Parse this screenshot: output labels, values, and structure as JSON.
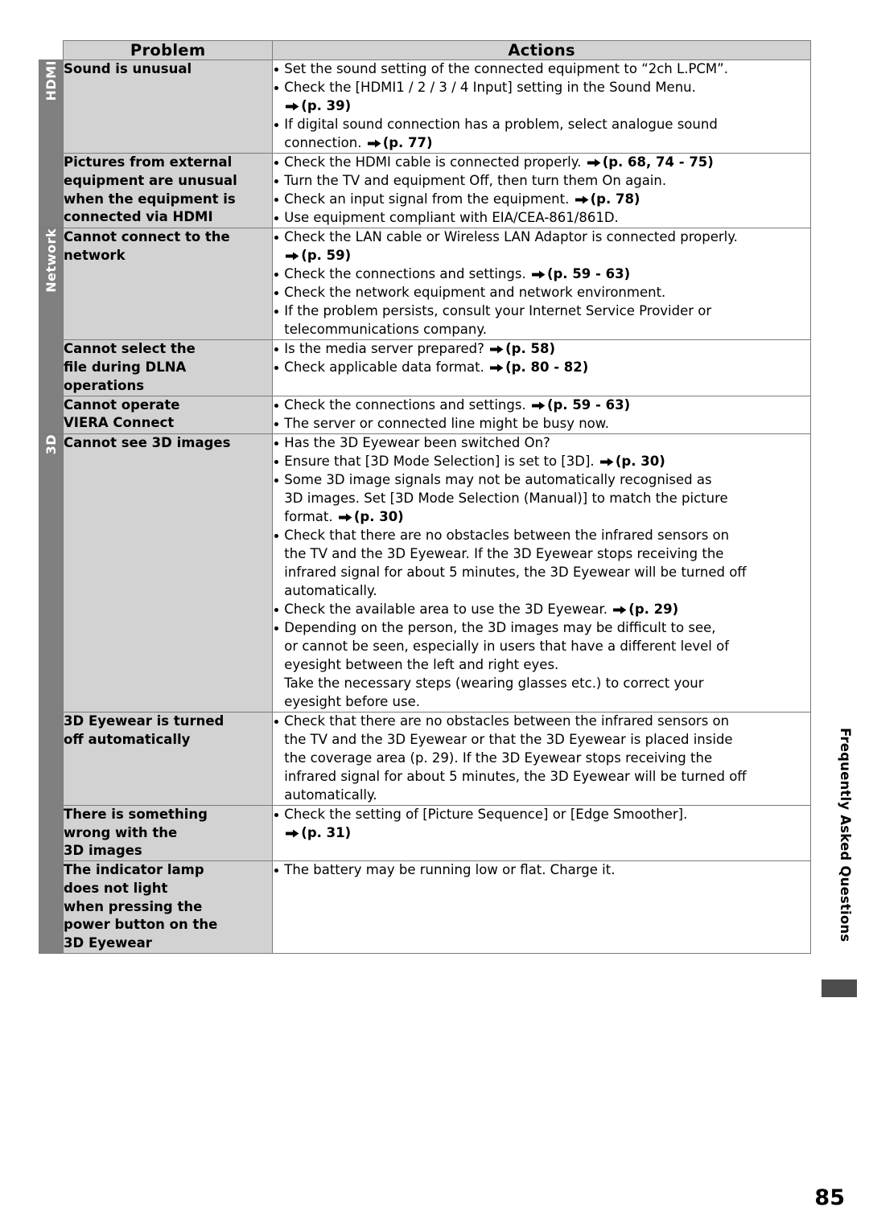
{
  "header": {
    "problem": "Problem",
    "actions": "Actions"
  },
  "side_caption": "Frequently Asked Questions",
  "page_number": "85",
  "tabs": {
    "hdmi": "HDMI",
    "network": "Network",
    "three_d": "3D"
  },
  "rows": [
    {
      "problem": [
        "Sound is unusual"
      ],
      "actions": [
        {
          "bullet": true,
          "parts": [
            {
              "t": "Set the sound setting of the connected equipment to “2ch L.PCM”."
            }
          ]
        },
        {
          "bullet": true,
          "parts": [
            {
              "t": "Check the [HDMI1 / 2 / 3 / 4 Input] setting in the Sound Menu."
            }
          ]
        },
        {
          "bullet": false,
          "parts": [
            {
              "arrow": true
            },
            {
              "t": "(p. 39)",
              "bold": true
            }
          ]
        },
        {
          "bullet": true,
          "parts": [
            {
              "t": "If digital sound connection has a problem, select analogue sound"
            }
          ]
        },
        {
          "bullet": false,
          "parts": [
            {
              "t": "connection. "
            },
            {
              "arrow": true
            },
            {
              "t": "(p. 77)",
              "bold": true
            }
          ]
        }
      ]
    },
    {
      "problem": [
        "Pictures from external",
        "equipment are unusual",
        "when the equipment is",
        "connected via HDMI"
      ],
      "actions": [
        {
          "bullet": true,
          "parts": [
            {
              "t": "Check the HDMI cable is connected properly. "
            },
            {
              "arrow": true
            },
            {
              "t": "(p. 68, 74 - 75)",
              "bold": true
            }
          ]
        },
        {
          "bullet": true,
          "parts": [
            {
              "t": "Turn the TV and equipment Off, then turn them On again."
            }
          ]
        },
        {
          "bullet": true,
          "parts": [
            {
              "t": "Check an input signal from the equipment. "
            },
            {
              "arrow": true
            },
            {
              "t": "(p. 78)",
              "bold": true
            }
          ]
        },
        {
          "bullet": true,
          "parts": [
            {
              "t": "Use equipment compliant with EIA/CEA-861/861D."
            }
          ]
        }
      ]
    },
    {
      "problem": [
        "Cannot connect to the",
        "network"
      ],
      "actions": [
        {
          "bullet": true,
          "parts": [
            {
              "t": "Check the LAN cable or Wireless LAN Adaptor is connected properly."
            }
          ]
        },
        {
          "bullet": false,
          "parts": [
            {
              "arrow": true
            },
            {
              "t": "(p. 59)",
              "bold": true
            }
          ]
        },
        {
          "bullet": true,
          "parts": [
            {
              "t": "Check the connections and settings. "
            },
            {
              "arrow": true
            },
            {
              "t": "(p. 59 - 63)",
              "bold": true
            }
          ]
        },
        {
          "bullet": true,
          "parts": [
            {
              "t": "Check the network equipment and network environment."
            }
          ]
        },
        {
          "bullet": true,
          "parts": [
            {
              "t": "If the problem persists, consult your Internet Service Provider or"
            }
          ]
        },
        {
          "bullet": false,
          "parts": [
            {
              "t": "telecommunications company."
            }
          ]
        }
      ]
    },
    {
      "problem": [
        "Cannot select the",
        "file during DLNA",
        "operations"
      ],
      "actions": [
        {
          "bullet": true,
          "parts": [
            {
              "t": "Is the media server prepared? "
            },
            {
              "arrow": true
            },
            {
              "t": "(p. 58)",
              "bold": true
            }
          ]
        },
        {
          "bullet": true,
          "parts": [
            {
              "t": "Check applicable data format. "
            },
            {
              "arrow": true
            },
            {
              "t": "(p. 80 - 82)",
              "bold": true
            }
          ]
        }
      ]
    },
    {
      "problem": [
        "Cannot operate",
        "VIERA Connect"
      ],
      "actions": [
        {
          "bullet": true,
          "parts": [
            {
              "t": "Check the connections and settings. "
            },
            {
              "arrow": true
            },
            {
              "t": "(p. 59 - 63)",
              "bold": true
            }
          ]
        },
        {
          "bullet": true,
          "parts": [
            {
              "t": "The server or connected line might be busy now."
            }
          ]
        }
      ]
    },
    {
      "problem": [
        "Cannot see 3D images"
      ],
      "actions": [
        {
          "bullet": true,
          "parts": [
            {
              "t": "Has the 3D Eyewear been switched On?"
            }
          ]
        },
        {
          "bullet": true,
          "parts": [
            {
              "t": "Ensure that [3D Mode Selection] is set to [3D]. "
            },
            {
              "arrow": true
            },
            {
              "t": "(p. 30)",
              "bold": true
            }
          ]
        },
        {
          "bullet": true,
          "parts": [
            {
              "t": "Some 3D image signals may not be automatically recognised as"
            }
          ]
        },
        {
          "bullet": false,
          "parts": [
            {
              "t": "3D images. Set [3D Mode Selection (Manual)] to match the picture"
            }
          ]
        },
        {
          "bullet": false,
          "parts": [
            {
              "t": "format. "
            },
            {
              "arrow": true
            },
            {
              "t": "(p. 30)",
              "bold": true
            }
          ]
        },
        {
          "bullet": true,
          "parts": [
            {
              "t": "Check that there are no obstacles between the infrared sensors on"
            }
          ]
        },
        {
          "bullet": false,
          "parts": [
            {
              "t": "the TV and the 3D Eyewear. If the 3D Eyewear stops receiving the"
            }
          ]
        },
        {
          "bullet": false,
          "parts": [
            {
              "t": "infrared signal for about 5 minutes, the 3D Eyewear will be turned off"
            }
          ]
        },
        {
          "bullet": false,
          "parts": [
            {
              "t": "automatically."
            }
          ]
        },
        {
          "bullet": true,
          "parts": [
            {
              "t": "Check the available area to use the 3D Eyewear. "
            },
            {
              "arrow": true
            },
            {
              "t": "(p. 29)",
              "bold": true
            }
          ]
        },
        {
          "bullet": true,
          "parts": [
            {
              "t": "Depending on the person, the 3D images may be difficult to see,"
            }
          ]
        },
        {
          "bullet": false,
          "parts": [
            {
              "t": "or cannot be seen, especially in users that have a different level of"
            }
          ]
        },
        {
          "bullet": false,
          "parts": [
            {
              "t": "eyesight between the left and right eyes."
            }
          ]
        },
        {
          "bullet": false,
          "parts": [
            {
              "t": "Take the necessary steps (wearing glasses etc.) to correct your"
            }
          ]
        },
        {
          "bullet": false,
          "parts": [
            {
              "t": "eyesight before use."
            }
          ]
        }
      ]
    },
    {
      "problem": [
        "3D Eyewear is turned",
        "off automatically"
      ],
      "actions": [
        {
          "bullet": true,
          "parts": [
            {
              "t": "Check that there are no obstacles between the infrared sensors on"
            }
          ]
        },
        {
          "bullet": false,
          "parts": [
            {
              "t": "the TV and the 3D Eyewear or that the 3D Eyewear is placed inside"
            }
          ]
        },
        {
          "bullet": false,
          "parts": [
            {
              "t": "the coverage area (p. 29). If the 3D Eyewear stops receiving the"
            }
          ]
        },
        {
          "bullet": false,
          "parts": [
            {
              "t": "infrared signal for about 5 minutes, the 3D Eyewear will be turned off"
            }
          ]
        },
        {
          "bullet": false,
          "parts": [
            {
              "t": "automatically."
            }
          ]
        }
      ]
    },
    {
      "problem": [
        "There is something",
        "wrong with the",
        "3D images"
      ],
      "actions": [
        {
          "bullet": true,
          "parts": [
            {
              "t": "Check the setting of [Picture Sequence] or [Edge Smoother]."
            }
          ]
        },
        {
          "bullet": false,
          "parts": [
            {
              "arrow": true
            },
            {
              "t": "(p. 31)",
              "bold": true
            }
          ]
        }
      ]
    },
    {
      "problem": [
        "The indicator lamp",
        "does not light",
        "when pressing the",
        "power button on the",
        "3D Eyewear"
      ],
      "actions": [
        {
          "bullet": true,
          "parts": [
            {
              "t": "The battery may be running low or flat. Charge it."
            }
          ]
        }
      ]
    }
  ]
}
